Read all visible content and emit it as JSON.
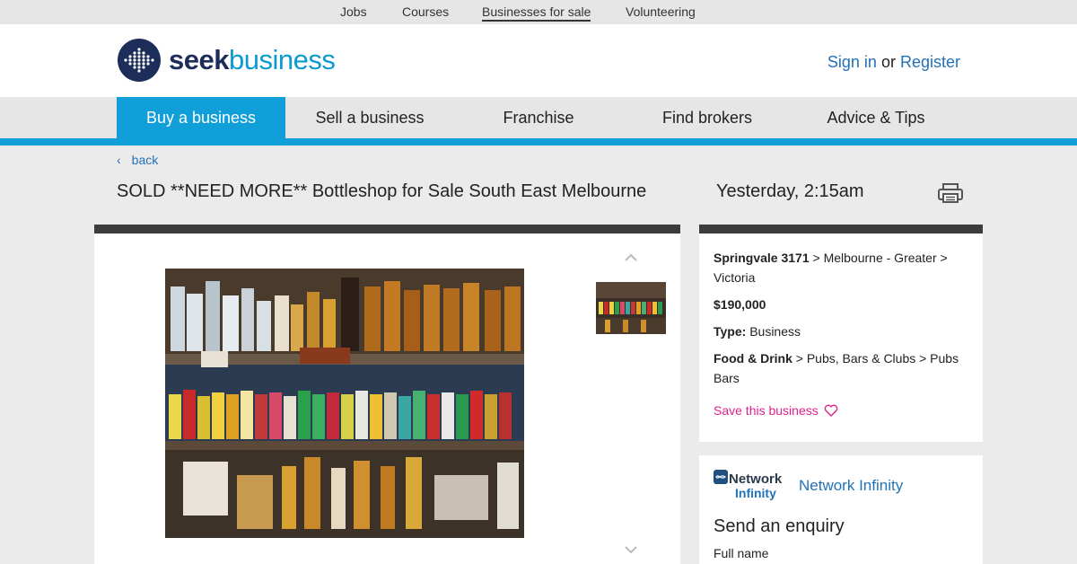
{
  "topnav": {
    "items": [
      {
        "label": "Jobs"
      },
      {
        "label": "Courses"
      },
      {
        "label": "Businesses for sale",
        "active": true
      },
      {
        "label": "Volunteering"
      }
    ]
  },
  "header": {
    "logo_seek": "seek",
    "logo_business": "business",
    "sign_in": "Sign in",
    "or": "or",
    "register": "Register"
  },
  "nav": {
    "items": [
      {
        "label": "Buy a business",
        "active": true
      },
      {
        "label": "Sell a business"
      },
      {
        "label": "Franchise"
      },
      {
        "label": "Find brokers"
      },
      {
        "label": "Advice & Tips"
      }
    ]
  },
  "listing": {
    "back": "back",
    "title": "SOLD **NEED MORE** Bottleshop for Sale South East Melbourne",
    "date": "Yesterday, 2:15am",
    "location_suburb": "Springvale 3171",
    "location_rest": " > Melbourne - Greater > Victoria",
    "price": "$190,000",
    "type_label": "Type:",
    "type_value": " Business",
    "category_main": "Food & Drink",
    "category_rest": " > Pubs, Bars & Clubs > Pubs Bars",
    "save_label": "Save this business"
  },
  "enquiry": {
    "logo_line1": "Network",
    "logo_line2": "Infinity",
    "broker_name": "Network Infinity",
    "title": "Send an enquiry",
    "full_name_label": "Full name"
  },
  "colors": {
    "accent": "#109fd8",
    "link": "#2272b9",
    "save": "#e0218a",
    "brand_navy": "#1c2d5a"
  },
  "icons": [
    "back-chevron-icon",
    "print-icon",
    "chevron-up-icon",
    "chevron-down-icon",
    "heart-icon"
  ]
}
